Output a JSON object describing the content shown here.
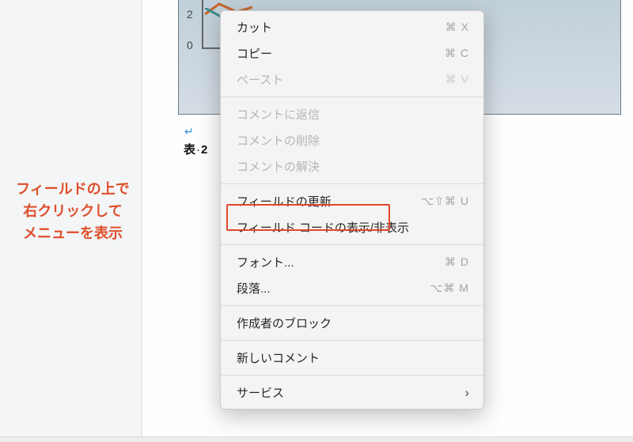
{
  "chart": {
    "tick2": "2",
    "tick0": "0"
  },
  "doc": {
    "table_caption_prefix": "表",
    "table_caption_sep": "·",
    "table_caption_num": "2"
  },
  "annotation": {
    "line1": "フィールドの上で",
    "line2": "右クリックして",
    "line3": "メニューを表示"
  },
  "menu": {
    "cut": {
      "label": "カット",
      "shortcut": "⌘ X"
    },
    "copy": {
      "label": "コピー",
      "shortcut": "⌘ C"
    },
    "paste": {
      "label": "ペースト",
      "shortcut": "⌘ V"
    },
    "reply_comment": {
      "label": "コメントに返信"
    },
    "delete_comment": {
      "label": "コメントの削除"
    },
    "resolve_comment": {
      "label": "コメントの解決"
    },
    "update_field": {
      "label": "フィールドの更新",
      "shortcut": "⌥⇧⌘ U"
    },
    "toggle_field": {
      "label": "フィールド コードの表示/非表示"
    },
    "font": {
      "label": "フォント...",
      "shortcut": "⌘ D"
    },
    "paragraph": {
      "label": "段落...",
      "shortcut": "⌥⌘ M"
    },
    "block_author": {
      "label": "作成者のブロック"
    },
    "new_comment": {
      "label": "新しいコメント"
    },
    "services": {
      "label": "サービス"
    }
  }
}
